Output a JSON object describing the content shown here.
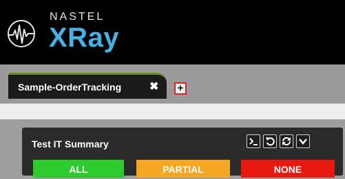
{
  "header": {
    "brand": "NASTEL",
    "product": "XRay"
  },
  "tabs": [
    {
      "label": "Sample-OrderTracking",
      "close": "✖",
      "active": true
    }
  ],
  "add_tab": {
    "label": "+"
  },
  "widget": {
    "title": "Test IT Summary",
    "toolbar_icons": [
      "terminal-icon",
      "undo-icon",
      "refresh-icon",
      "chevron-down-icon"
    ],
    "filters": [
      {
        "label": "ALL",
        "color": "#2ecb2e"
      },
      {
        "label": "PARTIAL",
        "color": "#f5a623"
      },
      {
        "label": "NONE",
        "color": "#e8190f"
      }
    ]
  },
  "colors": {
    "header_bg": "#000000",
    "product_blue": "#45b2e6",
    "tab_active_bg": "#1b1b1b",
    "tab_active_border": "#6b8f2f",
    "add_tab_highlight": "#e0231e"
  }
}
